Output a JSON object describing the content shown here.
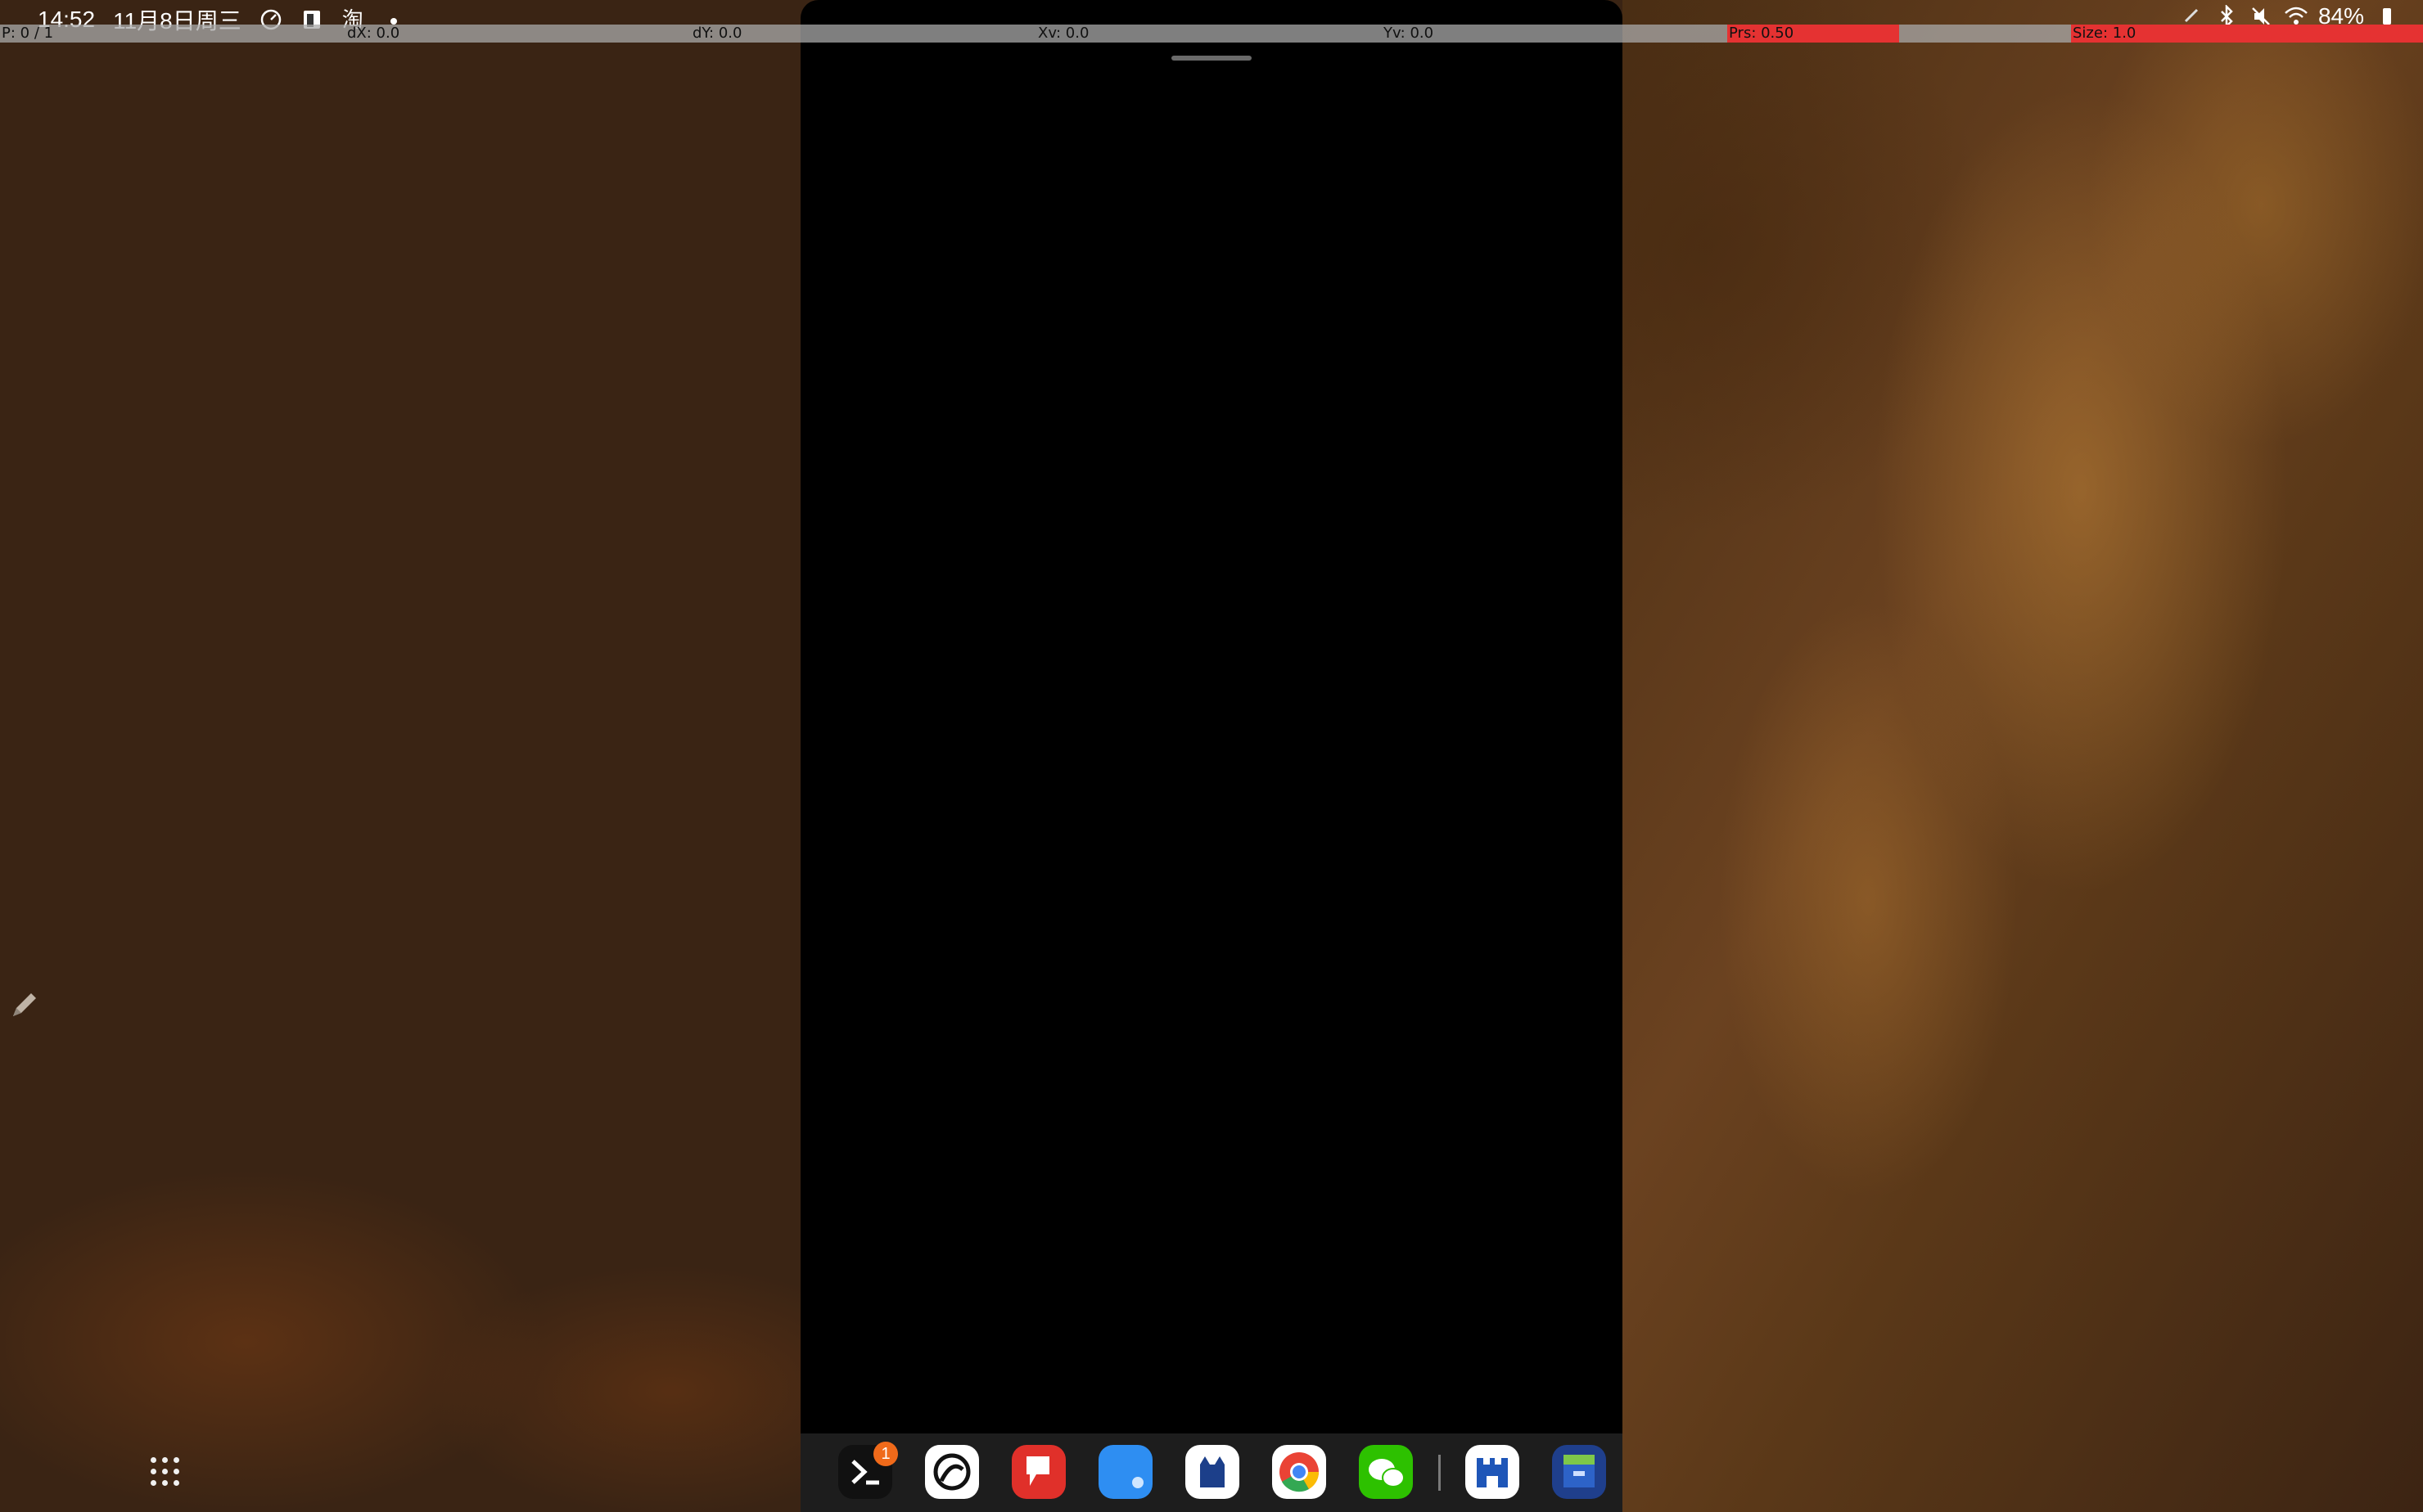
{
  "status_bar": {
    "time": "14:52",
    "date": "11月8日周三",
    "notification_icons": [
      "speedometer-icon",
      "phone-card-icon",
      "taobao-icon",
      "more-dot-icon"
    ],
    "taobao_glyph": "淘",
    "battery": "84%",
    "right_icons": [
      "pen-icon",
      "bluetooth-icon",
      "mute-icon",
      "wifi-icon",
      "battery-icon"
    ]
  },
  "pointer_overlay": {
    "pointers": "P: 0 / 1",
    "dx": "dX: 0.0",
    "dy": "dY: 0.0",
    "xv": "Xv: 0.0",
    "yv": "Yv: 0.0",
    "prs": "Prs: 0.50",
    "size": "Size: 1.0"
  },
  "taskbar": {
    "apps": [
      {
        "name": "terminal",
        "icon": "terminal-icon",
        "badge": "1"
      },
      {
        "name": "bytedance-app",
        "icon": "swirl-logo-icon"
      },
      {
        "name": "red-app",
        "icon": "red-flag-icon"
      },
      {
        "name": "blue-chat-app",
        "icon": "blue-chat-icon"
      },
      {
        "name": "cat-app",
        "icon": "cat-icon"
      },
      {
        "name": "chrome",
        "icon": "chrome-icon"
      },
      {
        "name": "wechat",
        "icon": "wechat-icon"
      },
      {
        "name": "castle-app",
        "icon": "castle-icon"
      },
      {
        "name": "archive-app",
        "icon": "archive-box-icon"
      }
    ]
  },
  "colors": {
    "wallpaper": "#3a2414",
    "overlay_red": "#e53232",
    "badge": "#f06a1a",
    "chrome_red": "#ea4335",
    "chrome_green": "#34a853",
    "chrome_yellow": "#fbbc05",
    "chrome_blue": "#4285f4",
    "wechat_green": "#2dc100"
  }
}
